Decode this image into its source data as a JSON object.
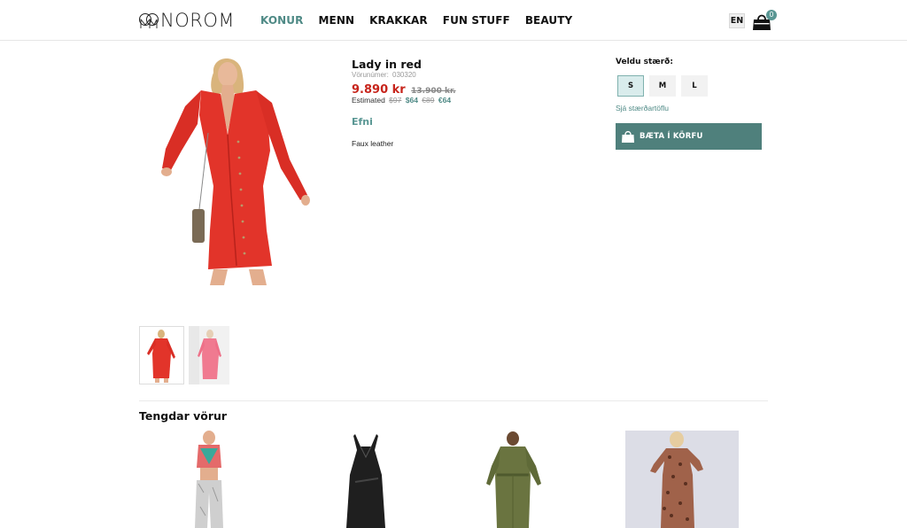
{
  "header": {
    "logo_text": "NOROM",
    "nav": [
      "KONUR",
      "MENN",
      "KRAKKAR",
      "FUN STUFF",
      "BEAUTY"
    ],
    "active_nav": "KONUR",
    "language": "EN",
    "cart_count": "0"
  },
  "product": {
    "title": "Lady in red",
    "sku_label": "Vörunúmer:",
    "sku": "030320",
    "price": "9.890 kr",
    "old_price": "13.900 kr.",
    "estimated_label": "Estimated",
    "estimated_old_usd": "$97",
    "estimated_usd": "$64",
    "estimated_old_eur": "€89",
    "estimated_eur": "€64",
    "material_heading": "Efni",
    "material": "Faux leather"
  },
  "size_selector": {
    "label": "Veldu stærð:",
    "sizes": [
      "S",
      "M",
      "L"
    ],
    "selected": "S",
    "size_chart_link": "Sjá stærðartöflu"
  },
  "add_to_cart": {
    "label": "BÆTA Í KÖRFU"
  },
  "related": {
    "title": "Tengdar vörur"
  },
  "colors": {
    "accent": "#4f8a86",
    "price_red": "#c7251c",
    "button": "#4f807c"
  }
}
